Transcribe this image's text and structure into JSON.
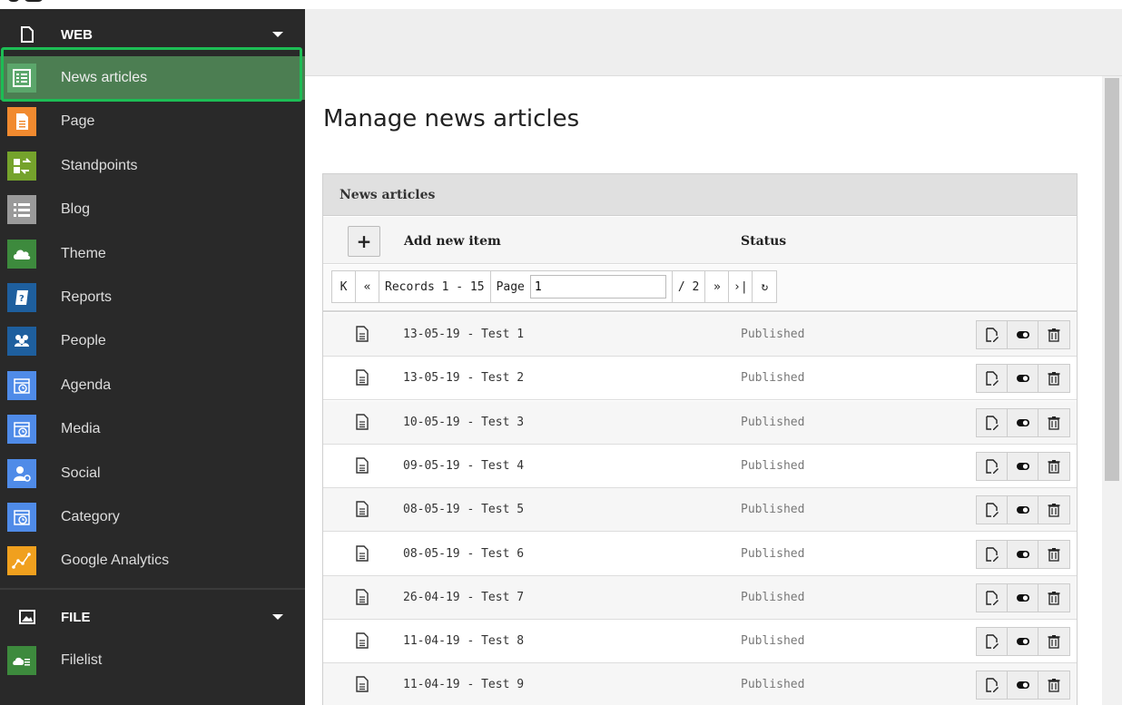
{
  "sidebar": {
    "web_section": {
      "label": "WEB",
      "icon": "page-icon"
    },
    "items": [
      {
        "label": "News articles",
        "icon": "table-list-icon",
        "color": "#5ba66b",
        "active": true
      },
      {
        "label": "Page",
        "icon": "document-icon",
        "color": "#f18a2f"
      },
      {
        "label": "Standpoints",
        "icon": "swap-icon",
        "color": "#75a32c"
      },
      {
        "label": "Blog",
        "icon": "list-icon",
        "color": "#9a9a9a"
      },
      {
        "label": "Theme",
        "icon": "cloud-icon",
        "color": "#3d8a3d"
      },
      {
        "label": "Reports",
        "icon": "report-icon",
        "color": "#1e5f9e"
      },
      {
        "label": "People",
        "icon": "people-icon",
        "color": "#1e5f9e"
      },
      {
        "label": "Agenda",
        "icon": "calendar-icon",
        "color": "#4f8be8"
      },
      {
        "label": "Media",
        "icon": "calendar-icon",
        "color": "#4f8be8"
      },
      {
        "label": "Social",
        "icon": "user-settings-icon",
        "color": "#4f8be8"
      },
      {
        "label": "Category",
        "icon": "calendar-icon",
        "color": "#4f8be8"
      },
      {
        "label": "Google Analytics",
        "icon": "analytics-icon",
        "color": "#f0a01e"
      }
    ],
    "file_section": {
      "label": "FILE",
      "icon": "image-icon"
    },
    "file_items": [
      {
        "label": "Filelist",
        "icon": "folder-cloud-icon",
        "color": "#3d8a3d"
      }
    ]
  },
  "main": {
    "title": "Manage news articles",
    "panel_title": "News articles",
    "columns": {
      "add": "Add new item",
      "status": "Status"
    },
    "add_button": "+",
    "pager": {
      "first": "K",
      "prev": "«",
      "records": "Records 1 - 15",
      "page_label": "Page",
      "page_value": "1",
      "total": "/ 2",
      "next": "»",
      "last": "›|",
      "refresh": "↻"
    },
    "rows": [
      {
        "title": "13-05-19 - Test 1",
        "status": "Published"
      },
      {
        "title": "13-05-19 - Test 2",
        "status": "Published"
      },
      {
        "title": "10-05-19 - Test 3",
        "status": "Published"
      },
      {
        "title": "09-05-19 - Test 4",
        "status": "Published"
      },
      {
        "title": "08-05-19 - Test 5",
        "status": "Published"
      },
      {
        "title": "08-05-19 - Test 6",
        "status": "Published"
      },
      {
        "title": "26-04-19 - Test 7",
        "status": "Published"
      },
      {
        "title": "11-04-19 - Test 8",
        "status": "Published"
      },
      {
        "title": "11-04-19 - Test 9",
        "status": "Published"
      }
    ]
  }
}
